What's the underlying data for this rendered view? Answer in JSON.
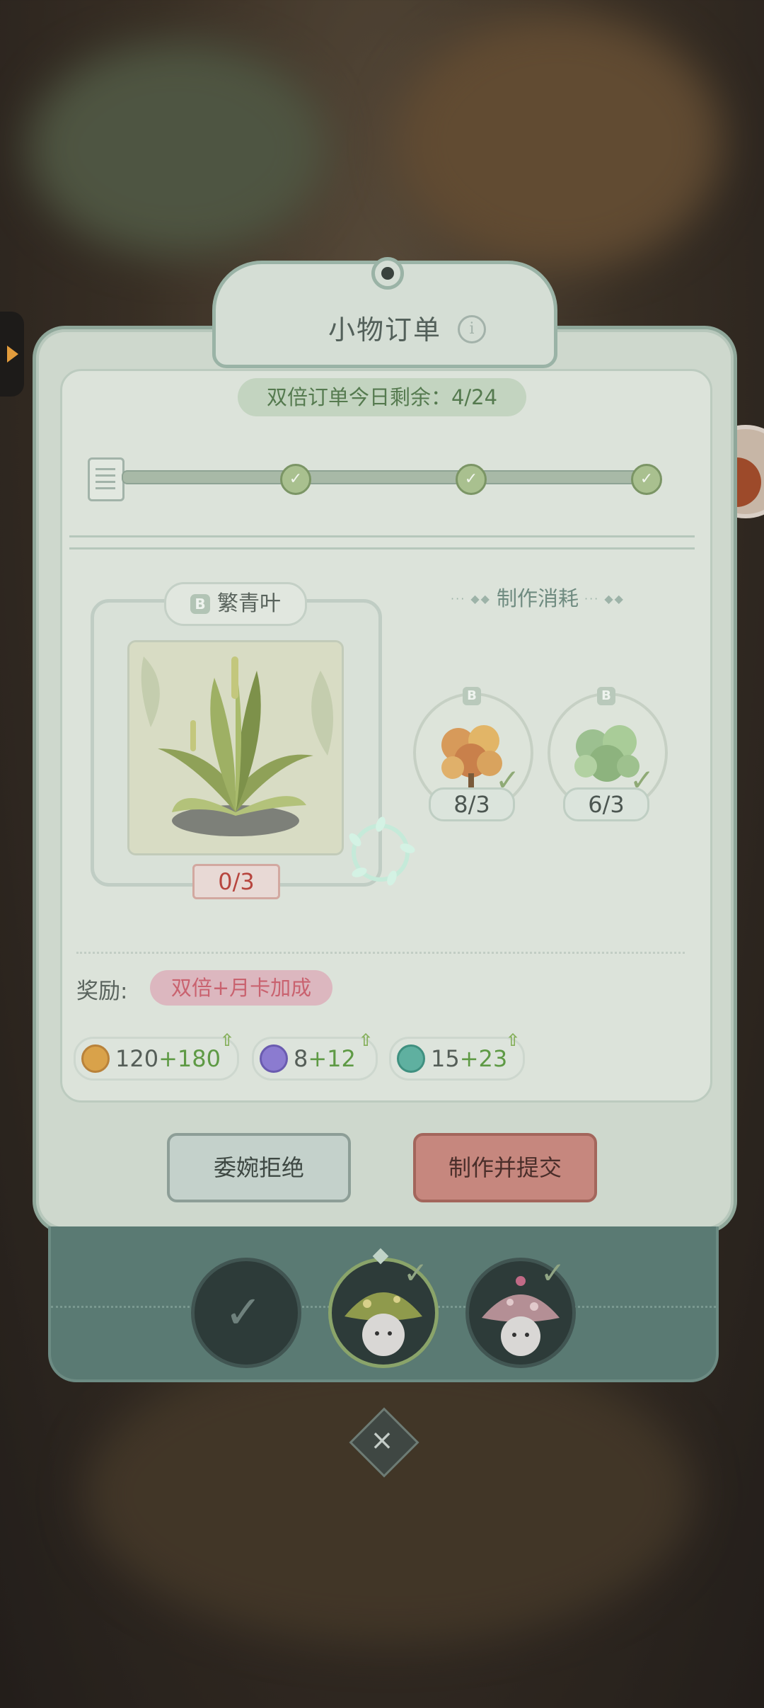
{
  "panel": {
    "title": "小物订单",
    "double_order_banner": "双倍订单今日剩余：4/24",
    "progress_checkpoints": 3
  },
  "item": {
    "grade": "B",
    "name": "繁青叶",
    "count": "0/3"
  },
  "consumption": {
    "title": "制作消耗",
    "materials": [
      {
        "grade": "B",
        "icon": "orange-flower-bouquet",
        "count": "8/3",
        "satisfied": true
      },
      {
        "grade": "B",
        "icon": "green-clover-bouquet",
        "count": "6/3",
        "satisfied": true
      }
    ]
  },
  "reward": {
    "label": "奖励:",
    "bonus_tag": "双倍+月卡加成",
    "resources": [
      {
        "icon": "coin-icon",
        "base": "120",
        "bonus": "+180",
        "color": "#d9a24a"
      },
      {
        "icon": "gem-icon",
        "base": "8",
        "bonus": "+12",
        "color": "#8b7bd0"
      },
      {
        "icon": "exp-icon",
        "base": "15",
        "bonus": "+23",
        "color": "#5fb0a0"
      }
    ]
  },
  "buttons": {
    "reject": "委婉拒绝",
    "submit": "制作并提交"
  },
  "colors": {
    "panel_bg": "#ced8cd",
    "submit_btn": "#c6877e",
    "count_red": "#b7453e",
    "bonus_green": "#5e9a45"
  }
}
